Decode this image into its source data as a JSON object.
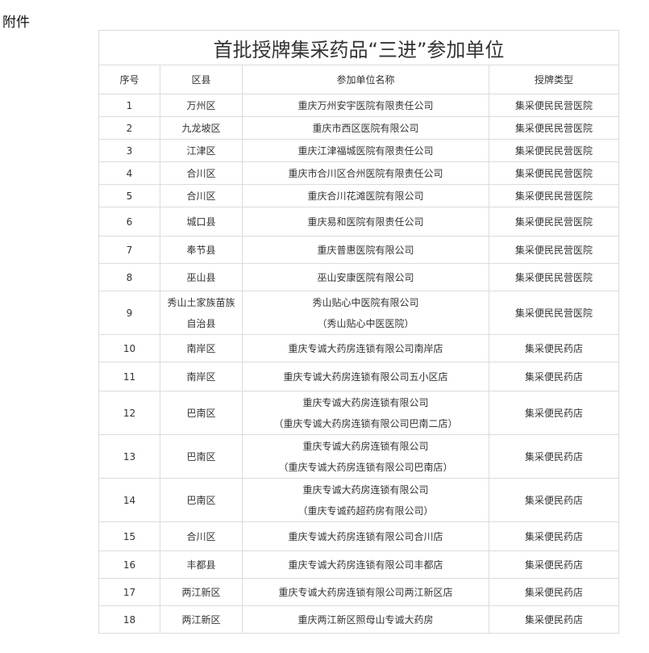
{
  "attachment_label": "附件",
  "table": {
    "title": "首批授牌集采药品“三进”参加单位",
    "headers": [
      "序号",
      "区县",
      "参加单位名称",
      "授牌类型"
    ],
    "rows": [
      {
        "no": "1",
        "district": [
          "万州区"
        ],
        "unit": [
          "重庆万州安宇医院有限责任公司"
        ],
        "type": "集采便民民营医院"
      },
      {
        "no": "2",
        "district": [
          "九龙坡区"
        ],
        "unit": [
          "重庆市西区医院有限公司"
        ],
        "type": "集采便民民营医院"
      },
      {
        "no": "3",
        "district": [
          "江津区"
        ],
        "unit": [
          "重庆江津福城医院有限责任公司"
        ],
        "type": "集采便民民营医院"
      },
      {
        "no": "4",
        "district": [
          "合川区"
        ],
        "unit": [
          "重庆市合川区合州医院有限责任公司"
        ],
        "type": "集采便民民营医院"
      },
      {
        "no": "5",
        "district": [
          "合川区"
        ],
        "unit": [
          "重庆合川花滩医院有限公司"
        ],
        "type": "集采便民民营医院"
      },
      {
        "no": "6",
        "district": [
          "城口县"
        ],
        "unit": [
          "重庆易和医院有限责任公司"
        ],
        "type": "集采便民民营医院"
      },
      {
        "no": "7",
        "district": [
          "奉节县"
        ],
        "unit": [
          "重庆普惠医院有限公司"
        ],
        "type": "集采便民民营医院"
      },
      {
        "no": "8",
        "district": [
          "巫山县"
        ],
        "unit": [
          "巫山安康医院有限公司"
        ],
        "type": "集采便民民营医院"
      },
      {
        "no": "9",
        "district": [
          "秀山土家族苗族",
          "自治县"
        ],
        "unit": [
          "秀山贴心中医院有限公司",
          "（秀山贴心中医医院）"
        ],
        "type": "集采便民民营医院"
      },
      {
        "no": "10",
        "district": [
          "南岸区"
        ],
        "unit": [
          "重庆专诚大药房连锁有限公司南岸店"
        ],
        "type": "集采便民药店"
      },
      {
        "no": "11",
        "district": [
          "南岸区"
        ],
        "unit": [
          "重庆专诚大药房连锁有限公司五小区店"
        ],
        "type": "集采便民药店"
      },
      {
        "no": "12",
        "district": [
          "巴南区"
        ],
        "unit": [
          "重庆专诚大药房连锁有限公司",
          "（重庆专诚大药房连锁有限公司巴南二店）"
        ],
        "type": "集采便民药店"
      },
      {
        "no": "13",
        "district": [
          "巴南区"
        ],
        "unit": [
          "重庆专诚大药房连锁有限公司",
          "（重庆专诚大药房连锁有限公司巴南店）"
        ],
        "type": "集采便民药店"
      },
      {
        "no": "14",
        "district": [
          "巴南区"
        ],
        "unit": [
          "重庆专诚大药房连锁有限公司",
          "（重庆专诚药超药房有限公司）"
        ],
        "type": "集采便民药店"
      },
      {
        "no": "15",
        "district": [
          "合川区"
        ],
        "unit": [
          "重庆专诚大药房连锁有限公司合川店"
        ],
        "type": "集采便民药店"
      },
      {
        "no": "16",
        "district": [
          "丰都县"
        ],
        "unit": [
          "重庆专诚大药房连锁有限公司丰都店"
        ],
        "type": "集采便民药店"
      },
      {
        "no": "17",
        "district": [
          "两江新区"
        ],
        "unit": [
          "重庆专诚大药房连锁有限公司两江新区店"
        ],
        "type": "集采便民药店"
      },
      {
        "no": "18",
        "district": [
          "两江新区"
        ],
        "unit": [
          "重庆两江新区照母山专诚大药房"
        ],
        "type": "集采便民药店"
      }
    ]
  }
}
